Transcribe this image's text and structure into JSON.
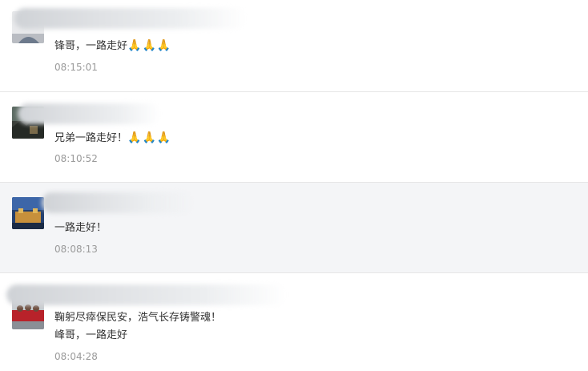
{
  "comments": [
    {
      "text": "锋哥，一路走好",
      "emoji": "🙏🙏🙏",
      "time": "08:15:01"
    },
    {
      "text": "兄弟一路走好！",
      "emoji": "🙏🙏🙏",
      "time": "08:10:52"
    },
    {
      "text": "一路走好！",
      "time": "08:08:13"
    },
    {
      "text_line1": "鞠躬尽瘁保民安，浩气长存铸警魂！",
      "text_line2": "峰哥，一路走好",
      "time": "08:04:28"
    }
  ],
  "colors": {
    "hover_row_background": "#f4f5f7",
    "divider": "#e6e6e6",
    "time_text": "#9a9a9a",
    "message_text": "#333333"
  }
}
